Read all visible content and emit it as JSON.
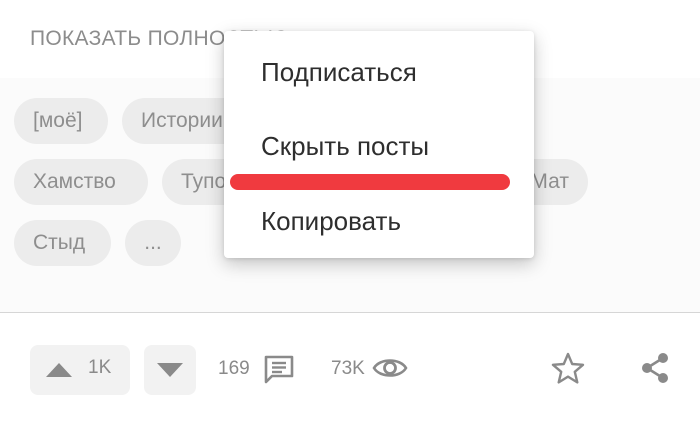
{
  "post": {
    "show_full_label": "ПОКАЗАТЬ ПОЛНОСТЬЮ"
  },
  "tags": [
    "[моё]",
    "Истории",
    "Хамство",
    "Тупость",
    "Мат",
    "Стыд",
    "..."
  ],
  "context_menu": {
    "items": [
      "Подписаться",
      "Скрыть посты",
      "Копировать"
    ]
  },
  "annotation": {
    "color": "#f03a3f",
    "marks": "Скрыть посты"
  },
  "actions": {
    "upvotes": "1K",
    "comments": "169",
    "views": "73K"
  },
  "icons": [
    "arrow-up-icon",
    "arrow-down-icon",
    "comment-icon",
    "eye-icon",
    "star-icon",
    "share-icon"
  ]
}
